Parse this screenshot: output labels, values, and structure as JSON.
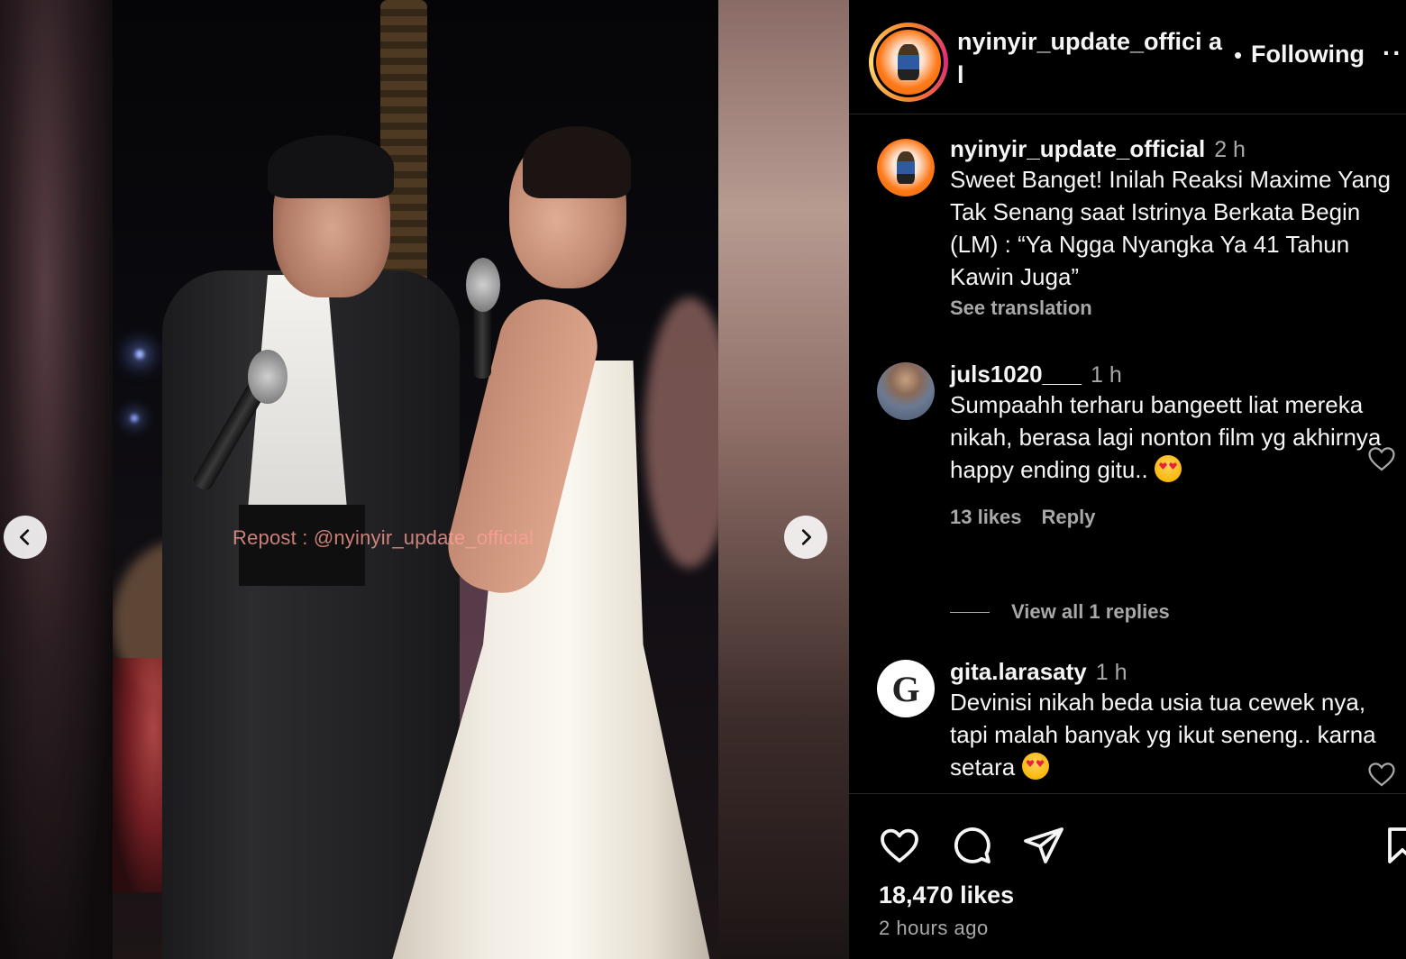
{
  "post": {
    "username": "nyinyir_update_official",
    "header_username_display": "nyinyir_update_offici al",
    "separator": "•",
    "follow_label": "Following",
    "more_label": "··",
    "watermark": "Repost : @nyinyir_update_official"
  },
  "caption": {
    "username": "nyinyir_update_official",
    "time": "2 h",
    "text": "Sweet Banget! Inilah Reaksi Maxime Yang Tak Senang saat Istrinya Berkata Begin (LM) : “Ya Ngga Nyangka Ya 41 Tahun Kawin Juga”",
    "see_translation": "See translation"
  },
  "comments": [
    {
      "username": "juls1020___",
      "time": "1 h",
      "text": "Sumpaahh terharu bangeett liat mereka nikah, berasa lagi nonton film yg akhirnya happy ending gitu..",
      "emoji": "heart-eyes",
      "likes": "13 likes",
      "reply_label": "Reply",
      "view_replies": "View all 1 replies"
    },
    {
      "username": "gita.larasaty",
      "time": "1 h",
      "avatar_letter": "G",
      "text": "Devinisi nikah beda usia tua cewek nya, tapi malah banyak yg ikut seneng.. karna setara",
      "emoji": "heart-eyes"
    }
  ],
  "actions": {
    "icons": [
      "heart-icon",
      "comment-icon",
      "share-icon",
      "bookmark-icon"
    ],
    "likes": "18,470 likes",
    "time_ago": "2 hours ago"
  },
  "colors": {
    "background": "#000000",
    "text_primary": "#f5f5f5",
    "text_secondary": "#a8a8a8",
    "divider": "#262626",
    "watermark": "#ffa096"
  }
}
